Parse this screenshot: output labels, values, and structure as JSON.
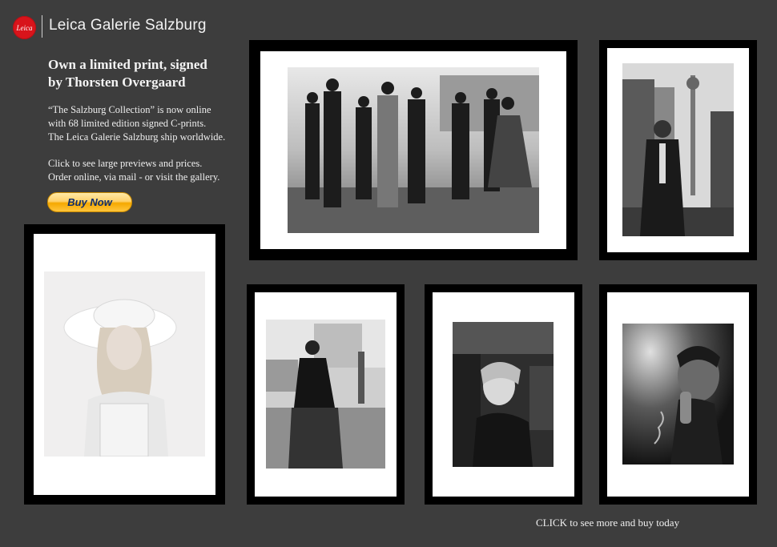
{
  "brand": {
    "logo_text": "Leica",
    "title": "Leica Galerie Salzburg",
    "logo_color": "#d8141b"
  },
  "promo": {
    "headline_line1": "Own a  limited print, signed",
    "headline_line2": "by Thorsten Overgaard",
    "desc_line1": "“The Salzburg Collection” is now online",
    "desc_line2": "with 68 limited edition signed C-prints.",
    "desc_line3": "The Leica Galerie Salzburg ship worldwide.",
    "desc_line4": "Click to see large previews and prices.",
    "desc_line5": "Order online, via mail - or visit the gallery.",
    "buy_label": "Buy Now"
  },
  "gallery": {
    "prints": [
      {
        "name": "group-walking-print"
      },
      {
        "name": "businessman-city-print"
      },
      {
        "name": "woman-in-white-hat-print"
      },
      {
        "name": "woman-walking-street-print"
      },
      {
        "name": "woman-in-crowd-print"
      },
      {
        "name": "man-smoking-print"
      }
    ]
  },
  "footer": {
    "cta": "CLICK to see more and buy today"
  }
}
